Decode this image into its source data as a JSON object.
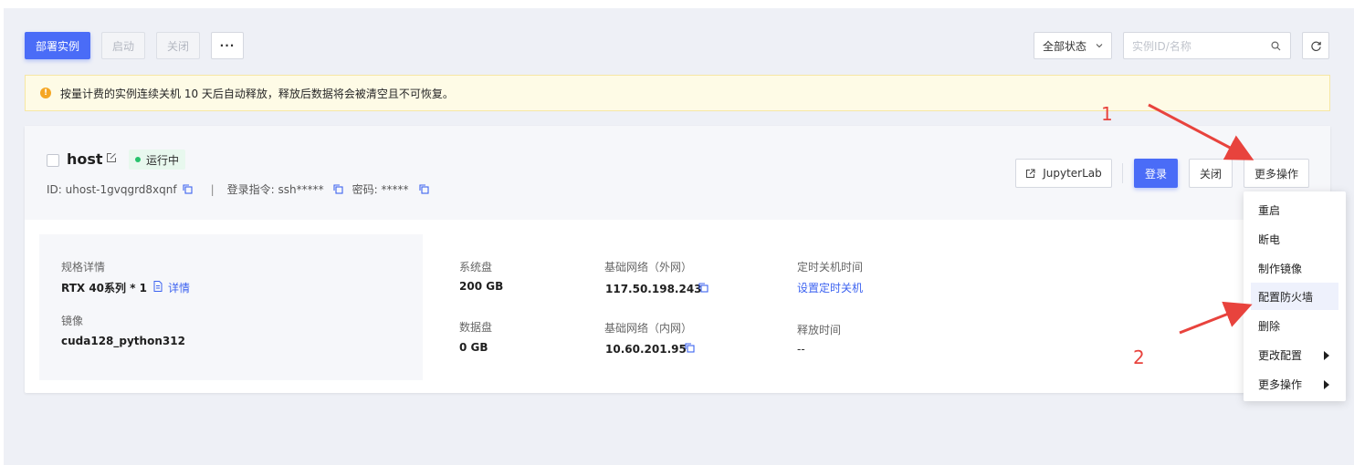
{
  "toolbar": {
    "deploy": "部署实例",
    "start": "启动",
    "close": "关闭",
    "more": "···",
    "status_filter": "全部状态",
    "search_placeholder": "实例ID/名称"
  },
  "notice": {
    "text": "按量计费的实例连续关机 10 天后自动释放，释放后数据将会被清空且不可恢复。"
  },
  "instance": {
    "name": "host",
    "status": "运行中",
    "id_text": "ID: uhost-1gvqgrd8xqnf",
    "separator": "|",
    "login_cmd": "登录指令: ssh*****",
    "password": "密码: *****",
    "actions": {
      "jupyter": "JupyterLab",
      "login": "登录",
      "close": "关闭",
      "more": "更多操作"
    },
    "spec": {
      "spec_label": "规格详情",
      "spec_value": "RTX 40系列 * 1",
      "detail_link": "详情",
      "image_label": "镜像",
      "image_value": "cuda128_python312"
    },
    "disks": {
      "system_label": "系统盘",
      "system_value": "200 GB",
      "data_label": "数据盘",
      "data_value": "0 GB"
    },
    "network": {
      "public_label": "基础网络（外网）",
      "public_ip": "117.50.198.243",
      "private_label": "基础网络（内网）",
      "private_ip": "10.60.201.95"
    },
    "schedule": {
      "shutdown_label": "定时关机时间",
      "shutdown_link": "设置定时关机",
      "release_label": "释放时间",
      "release_value": "--"
    }
  },
  "dropdown": {
    "items": [
      "重启",
      "断电",
      "制作镜像",
      "配置防火墙",
      "删除",
      "更改配置",
      "更多操作"
    ],
    "active_index": 3
  },
  "annotations": {
    "step1": "1",
    "step2": "2"
  },
  "colors": {
    "primary": "#4a6cf7",
    "annotation": "#e8433d",
    "running": "#27c26c"
  }
}
